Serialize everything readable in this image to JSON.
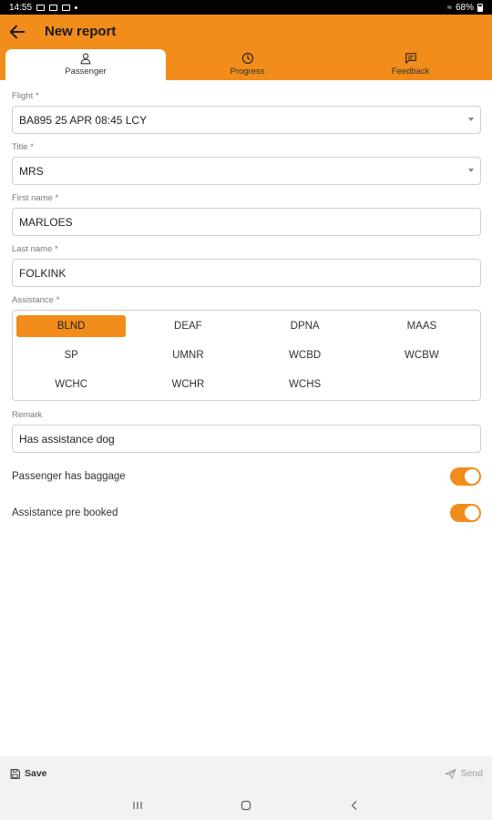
{
  "status_bar": {
    "time": "14:55",
    "battery": "68%"
  },
  "header": {
    "title": "New report"
  },
  "tabs": [
    {
      "label": "Passenger",
      "icon": "person-icon",
      "active": true
    },
    {
      "label": "Progress",
      "icon": "clock-icon",
      "active": false
    },
    {
      "label": "Feedback",
      "icon": "chat-icon",
      "active": false
    }
  ],
  "form": {
    "flight": {
      "label": "Flight *",
      "value": "BA895 25 APR 08:45 LCY"
    },
    "title": {
      "label": "Title *",
      "value": "MRS"
    },
    "first_name": {
      "label": "First name *",
      "value": "MARLOES"
    },
    "last_name": {
      "label": "Last name *",
      "value": "FOLKINK"
    },
    "assistance": {
      "label": "Assistance *",
      "options": [
        "BLND",
        "DEAF",
        "DPNA",
        "MAAS",
        "SP",
        "UMNR",
        "WCBD",
        "WCBW",
        "WCHC",
        "WCHR",
        "WCHS"
      ],
      "selected": "BLND"
    },
    "remark": {
      "label": "Remark",
      "value": "Has assistance dog"
    },
    "toggles": [
      {
        "label": "Passenger has baggage",
        "on": true
      },
      {
        "label": "Assistance pre booked",
        "on": true
      }
    ]
  },
  "actions": {
    "save": "Save",
    "send": "Send"
  },
  "colors": {
    "accent": "#F28C1A"
  }
}
